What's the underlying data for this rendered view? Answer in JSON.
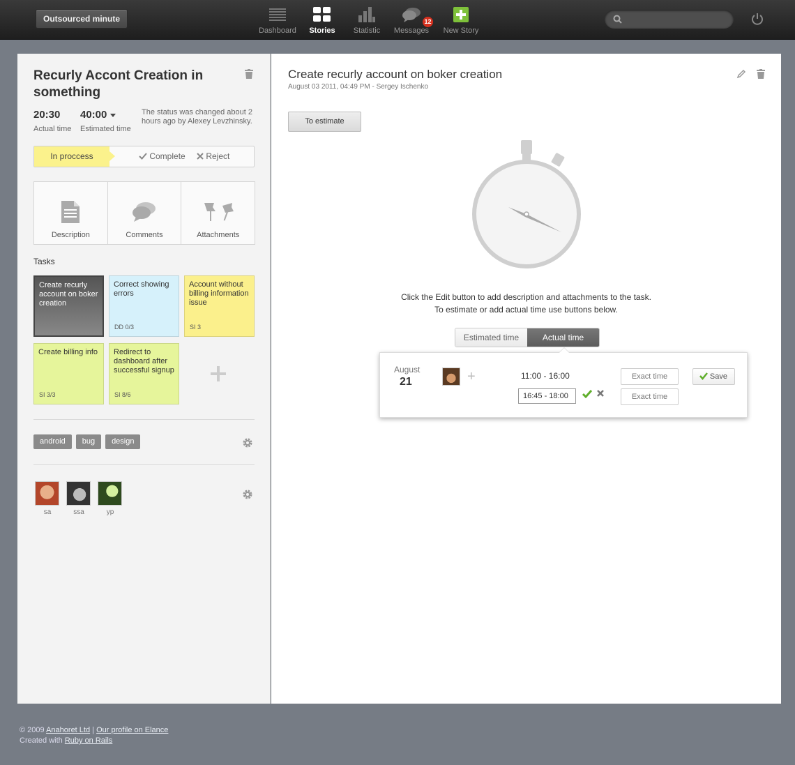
{
  "topbar": {
    "brand": "Outsourced minute",
    "nav": [
      {
        "label": "Dashboard",
        "icon": "dashboard-icon"
      },
      {
        "label": "Stories",
        "icon": "stories-icon",
        "active": true
      },
      {
        "label": "Statistic",
        "icon": "statistic-icon"
      },
      {
        "label": "Messages",
        "icon": "messages-icon",
        "badge": "12"
      },
      {
        "label": "New Story",
        "icon": "new-story-icon"
      }
    ],
    "search_placeholder": ""
  },
  "story": {
    "title": "Recurly Accont Creation in something",
    "actual_time": "20:30",
    "actual_label": "Actual time",
    "estimated_time": "40:00",
    "estimated_label": "Estimated time",
    "status_note": "The status was changed about 2 hours ago by Alexey Levzhinsky.",
    "status": {
      "current": "In proccess",
      "complete": "Complete",
      "reject": "Reject"
    },
    "tabs": [
      "Description",
      "Comments",
      "Attachments"
    ],
    "tasks_heading": "Tasks",
    "tasks": [
      {
        "title": "Create recurly account on boker creation",
        "code": ""
      },
      {
        "title": "Correct showing errors",
        "code": "DD 0/3"
      },
      {
        "title": "Account without billing information issue",
        "code": "SI 3"
      },
      {
        "title": "Create billing info",
        "code": "SI 3/3"
      },
      {
        "title": "Redirect to dashboard after successful signup",
        "code": "SI 8/6"
      }
    ],
    "tags": [
      "android",
      "bug",
      "design"
    ],
    "users": [
      "sa",
      "ssa",
      "yp"
    ]
  },
  "task_detail": {
    "title": "Create recurly account on boker creation",
    "meta": "August 03 2011, 04:49 PM - Sergey Ischenko",
    "to_estimate": "To estimate",
    "hint_line1": "Click the Edit button to add description and attachments to the task.",
    "hint_line2": "To estimate or add actual time use buttons below.",
    "toggle": {
      "estimated": "Estimated time",
      "actual": "Actual time"
    },
    "entry": {
      "month": "August",
      "day": "21",
      "range": "11:00 - 16:00",
      "input_value": "16:45 - 18:00",
      "exact1": "Exact time",
      "exact2": "Exact time",
      "save": "Save"
    }
  },
  "footer": {
    "copyright": "© 2009",
    "company": "Anahoret Ltd",
    "sep": "|",
    "profile": "Our profile on Elance",
    "created": "Created with",
    "rails": "Ruby on Rails"
  },
  "colors": {
    "accent_yellow": "#fbf28c",
    "task_blue": "#d6f1fb",
    "task_green": "#e6f59b",
    "badge_red": "#d6301e",
    "add_green": "#7ec13a"
  }
}
